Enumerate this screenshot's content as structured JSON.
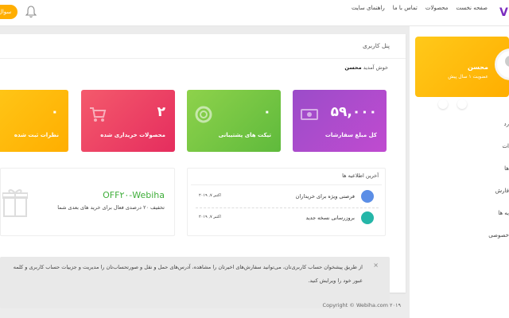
{
  "nav": {
    "logo": "V",
    "items": [
      "صفحه نخست",
      "محصولات",
      "تماس با ما",
      "راهنمای سایت"
    ],
    "ask_button": "سوال"
  },
  "panel": {
    "title": "پنل کاربری",
    "welcome_prefix": "خوش آمدید",
    "welcome_name": "محسن"
  },
  "cards": [
    {
      "value": "۵۹,۰۰۰",
      "label": "کل مبلغ سفارشات",
      "icon": "money-icon"
    },
    {
      "value": "۰",
      "label": "تیکت های پشتیبانی",
      "icon": "lifebuoy-icon"
    },
    {
      "value": "۲",
      "label": "محصولات خریداری شده",
      "icon": "cart-icon"
    },
    {
      "value": "۰",
      "label": "نظرات ثبت شده",
      "icon": "comment-icon"
    }
  ],
  "news": {
    "title": "آخرین اطلاعیه ها",
    "items": [
      {
        "text": "فرصتی ویژه برای خریداران",
        "date": "اکتبر ۷, ۲۰۱۹"
      },
      {
        "text": "بروزرسانی نسخه جدید",
        "date": "اکتبر ۷, ۲۰۱۹"
      }
    ]
  },
  "coupon": {
    "code": "OFF۲۰-Webiha",
    "text": "تخفیف ۲۰ درصدی فعال برای خرید های بعدی شما"
  },
  "alert": {
    "line1": "از طریق پیشخوان حساب کاربری‌تان، می‌توانید سفارش‌های اخیرتان را مشاهده، آدرس‌های حمل و نقل و صورتحساب‌تان را مدیریت و جزییات حساب کاربری و کلمه",
    "line2": "عبور خود را ویرایش کنید.",
    "close": "×"
  },
  "footer": "Copyright © Webiha.com ۲۰۱۹",
  "profile": {
    "name": "محسن",
    "since": "عضویت ۱ سال پیش"
  },
  "menu": [
    "رد",
    "ات",
    "ها",
    "فارش",
    "یه ها",
    "خصوصی"
  ]
}
